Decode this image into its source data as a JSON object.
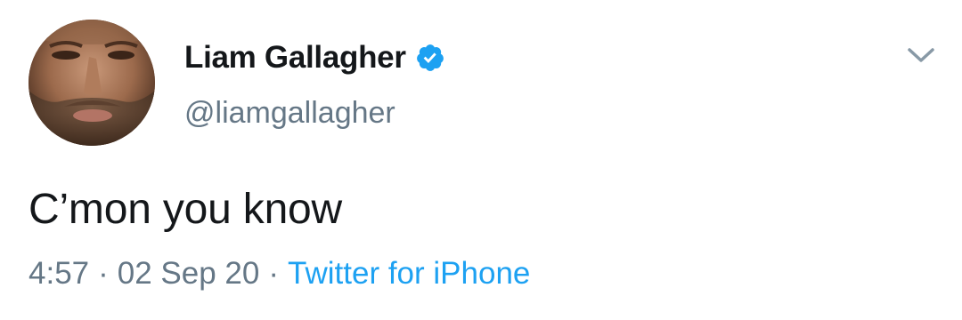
{
  "tweet": {
    "author": {
      "display_name": "Liam Gallagher",
      "handle": "@liamgallagher",
      "verified": true,
      "avatar_icon": "profile-photo"
    },
    "text": "C’mon you know",
    "time": "4:57",
    "date": "02 Sep 20",
    "separator": "·",
    "source": "Twitter for iPhone",
    "menu_icon": "chevron-down-icon"
  },
  "colors": {
    "text_primary": "#14171a",
    "text_secondary": "#657786",
    "accent": "#1da1f2"
  }
}
